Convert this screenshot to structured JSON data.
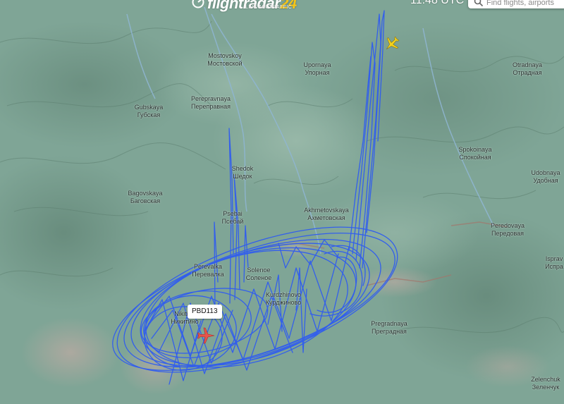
{
  "app": {
    "brand": "flightradar",
    "brand_number": "24",
    "tagline": "LIVE AIR TRAFFIC",
    "clock": "11:48 UTC",
    "logo_icon": "radar-icon"
  },
  "search": {
    "placeholder": "Find flights, airports",
    "icon": "search-icon"
  },
  "flight": {
    "callsign": "PBD113",
    "aircraft_color": "#e8544d",
    "track_color": "#2f5cf0"
  },
  "other_aircraft": {
    "color": "#f4d21c"
  },
  "colors": {
    "terrain": "#7fa596",
    "rivers": "#8fb6d4",
    "ridges": "#9a8a80"
  },
  "places": [
    {
      "latin": "Mostovskoy",
      "cyrillic": "Мостовской"
    },
    {
      "latin": "Upornaya",
      "cyrillic": "Упорная"
    },
    {
      "latin": "Otradnaya",
      "cyrillic": "Отрадная"
    },
    {
      "latin": "Perepravnaya",
      "cyrillic": "Переправная"
    },
    {
      "latin": "Gubskaya",
      "cyrillic": "Губская"
    },
    {
      "latin": "Spokoinaya",
      "cyrillic": "Спокойная"
    },
    {
      "latin": "Udobnaya",
      "cyrillic": "Удобная"
    },
    {
      "latin": "Shedok",
      "cyrillic": "Шедок"
    },
    {
      "latin": "Bagovskaya",
      "cyrillic": "Баговская"
    },
    {
      "latin": "Akhmetovskaya",
      "cyrillic": "Ахметовская"
    },
    {
      "latin": "Psebai",
      "cyrillic": "Псебай"
    },
    {
      "latin": "Peredovaya",
      "cyrillic": "Передовая"
    },
    {
      "latin": "Perevalka",
      "cyrillic": "Перевалка"
    },
    {
      "latin": "Solenoe",
      "cyrillic": "Соленое"
    },
    {
      "latin": "Isprav",
      "cyrillic": "Испра"
    },
    {
      "latin": "Kurdzhinovo",
      "cyrillic": "Курджиново"
    },
    {
      "latin": "Nikitino",
      "cyrillic": "Никитино"
    },
    {
      "latin": "Pregradnaya",
      "cyrillic": "Преградная"
    },
    {
      "latin": "Zelenchuk",
      "cyrillic": "Зеленчук"
    }
  ]
}
